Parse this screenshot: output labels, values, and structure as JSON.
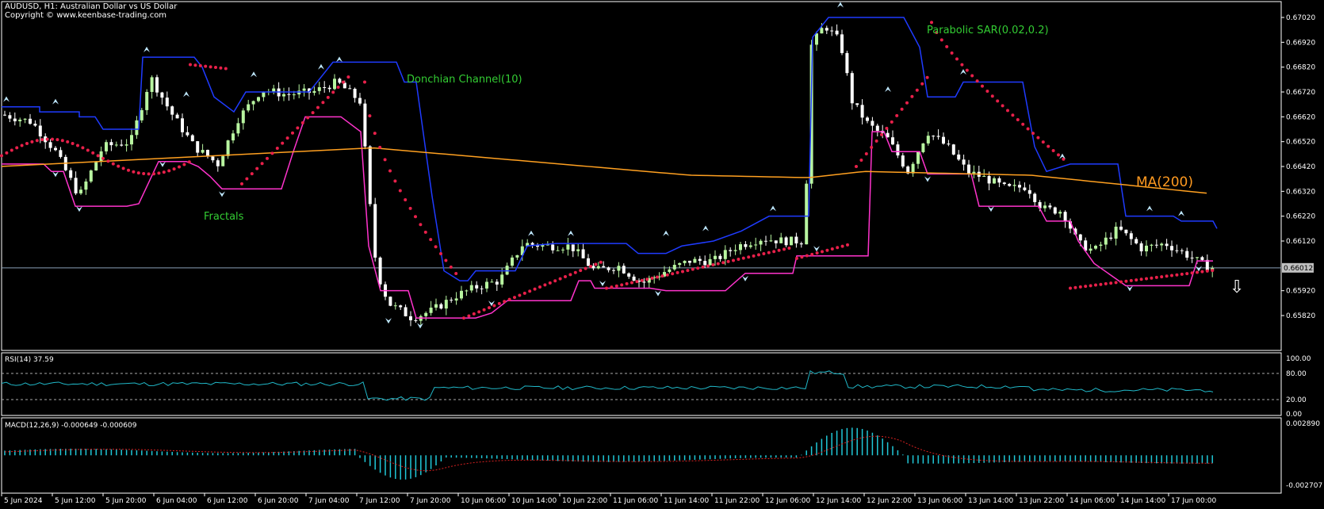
{
  "header": {
    "symbol_line": "AUDUSD, H1:  Australian Dollar vs US Dollar",
    "copyright": "Copyright © www.keenbase-trading.com"
  },
  "colors": {
    "background": "#000000",
    "bull_candle": "#b8f5a0",
    "bear_candle": "#ffffff",
    "donchian": "#1f3bff",
    "lower_band": "#ff33cc",
    "ma": "#ffa020",
    "sar": "#e8204a",
    "rsi": "#20b8c8",
    "macd_hist": "#20c8d8",
    "macd_signal": "#d82020",
    "label_green": "#33cc33",
    "label_orange": "#ff9a20",
    "price_line": "#8aa0b8"
  },
  "annotations": {
    "donchian": "Donchian Channel(10)",
    "parabolic": "Parabolic SAR(0.02,0.2)",
    "fractals": "Fractals",
    "ma": "MA(200)"
  },
  "chart_data": [
    {
      "type": "candlestick",
      "title": "AUDUSD, H1:  Australian Dollar vs US Dollar",
      "current_price": "0.66012",
      "y_ticks": [
        "0.67020",
        "0.66920",
        "0.66820",
        "0.66720",
        "0.66620",
        "0.66520",
        "0.66420",
        "0.66320",
        "0.66220",
        "0.66120",
        "0.65920",
        "0.65820"
      ],
      "x_ticks": [
        "5 Jun 2024",
        "5 Jun 12:00",
        "5 Jun 20:00",
        "6 Jun 04:00",
        "6 Jun 12:00",
        "6 Jun 20:00",
        "7 Jun 04:00",
        "7 Jun 12:00",
        "7 Jun 20:00",
        "10 Jun 06:00",
        "10 Jun 14:00",
        "10 Jun 22:00",
        "11 Jun 06:00",
        "11 Jun 14:00",
        "11 Jun 22:00",
        "12 Jun 06:00",
        "12 Jun 14:00",
        "12 Jun 22:00",
        "13 Jun 06:00",
        "13 Jun 14:00",
        "13 Jun 22:00",
        "14 Jun 06:00",
        "14 Jun 14:00",
        "17 Jun 00:00"
      ],
      "ylim": [
        0.6575,
        0.6706
      ],
      "indicators": [
        "Donchian Channel(10)",
        "Parabolic SAR(0.02,0.2)",
        "Fractals",
        "MA(200)"
      ]
    },
    {
      "type": "line",
      "title": "RSI(14) 37.59",
      "value": 37.59,
      "y_ticks": [
        "100.00",
        "80.00",
        "20.00",
        "0.00"
      ],
      "levels": [
        80,
        20
      ],
      "ylim": [
        0,
        100
      ]
    },
    {
      "type": "bar",
      "title": "MACD(12,26,9) -0.000649 -0.000609",
      "macd": -0.000649,
      "signal": -0.000609,
      "y_ticks": [
        "0.002890",
        "-0.002707"
      ],
      "ylim": [
        -0.002707,
        0.00289
      ]
    }
  ]
}
